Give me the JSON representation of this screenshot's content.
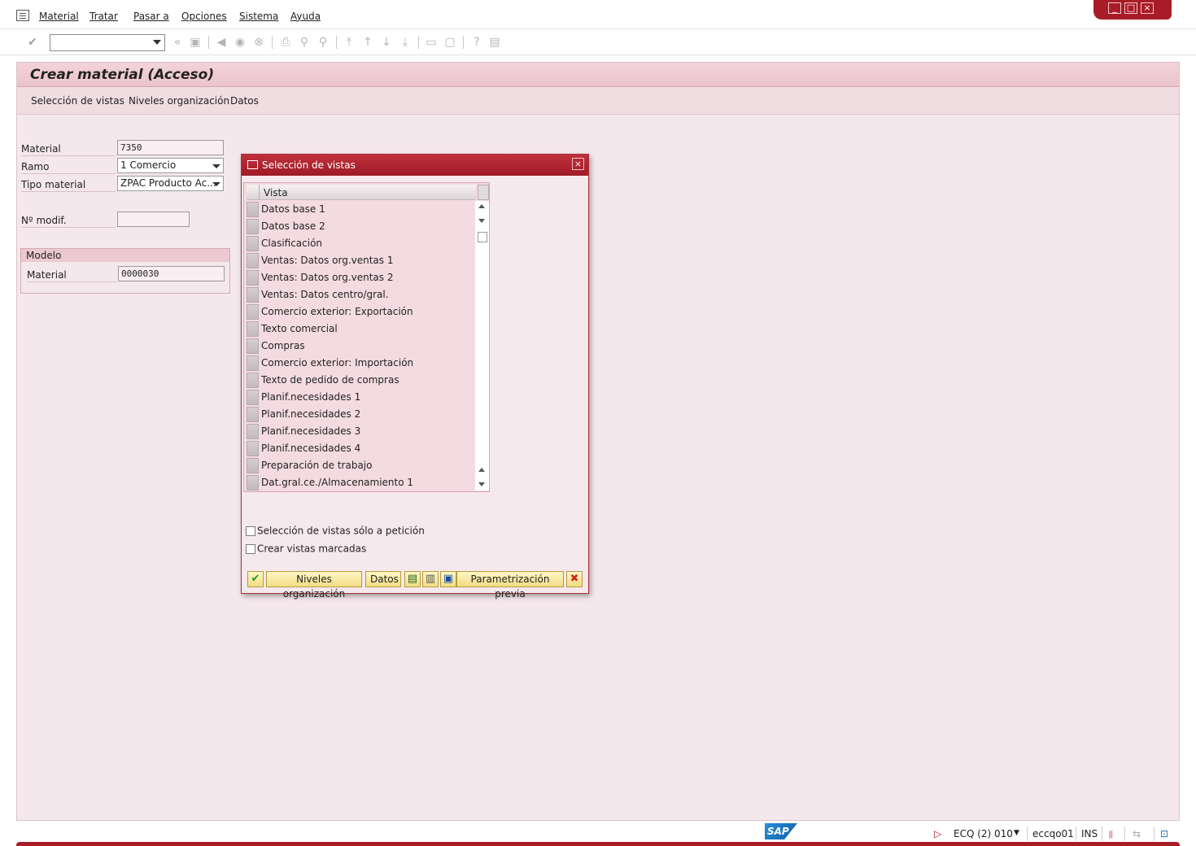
{
  "menu": {
    "items": [
      "Material",
      "Tratar",
      "Pasar a",
      "Opciones",
      "Sistema",
      "Ayuda"
    ]
  },
  "toolbar": {
    "command_value": ""
  },
  "screen": {
    "title": "Crear material (Acceso)",
    "app_buttons": [
      "Selección de vistas",
      "Niveles organización",
      "Datos"
    ]
  },
  "form": {
    "material_label": "Material",
    "material_value": "7350",
    "ramo_label": "Ramo",
    "ramo_value": "1 Comercio",
    "tipo_label": "Tipo material",
    "tipo_value": "ZPAC Producto Ac...",
    "nmodif_label": "Nº modif.",
    "nmodif_value": "",
    "modelo": {
      "title": "Modelo",
      "material_label": "Material",
      "material_value": "0000030"
    }
  },
  "dialog": {
    "title": "Selección de vistas",
    "column_header": "Vista",
    "views": [
      "Datos base 1",
      "Datos base 2",
      "Clasificación",
      "Ventas: Datos org.ventas 1",
      "Ventas: Datos org.ventas 2",
      "Ventas: Datos centro/gral.",
      "Comercio exterior: Exportación",
      "Texto comercial",
      "Compras",
      "Comercio exterior: Importación",
      "Texto de pedido de compras",
      "Planif.necesidades 1",
      "Planif.necesidades 2",
      "Planif.necesidades 3",
      "Planif.necesidades 4",
      "Preparación de trabajo",
      "Dat.gral.ce./Almacenamiento 1"
    ],
    "checkbox_on_request": "Selección de vistas sólo a petición",
    "checkbox_on_request_checked": false,
    "checkbox_create_marked": "Crear vistas marcadas",
    "checkbox_create_marked_checked": false,
    "btn_org_levels": "Niveles organización",
    "btn_data": "Datos",
    "btn_default": "Parametrización previa"
  },
  "status": {
    "system": "ECQ (2) 010",
    "server": "eccqo01",
    "mode": "INS"
  },
  "colors": {
    "brand": "#a81c27",
    "screen_bg": "#f5e8ec"
  }
}
